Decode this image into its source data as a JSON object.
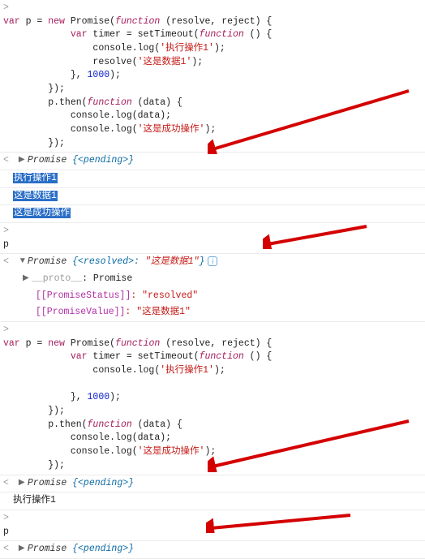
{
  "block1": {
    "l1a": "var",
    "l1b": " p = ",
    "l1c": "new",
    "l1d": " Promise(",
    "l1e": "function",
    "l1f": " (resolve, reject) {",
    "l2a": "            var",
    "l2b": " timer = setTimeout(",
    "l2c": "function",
    "l2d": " () {",
    "l3a": "                console.log(",
    "l3b": "'执行操作1'",
    "l3c": ");",
    "l4a": "                resolve(",
    "l4b": "'这是数据1'",
    "l4c": ");",
    "l5a": "            }, ",
    "l5b": "1000",
    "l5c": ");",
    "l6": "        });",
    "l7a": "        p.then(",
    "l7b": "function",
    "l7c": " (data) {",
    "l8": "            console.log(data);",
    "l9a": "            console.log(",
    "l9b": "'这是成功操作'",
    "l9c": ");",
    "l10": "        });"
  },
  "pendingA": {
    "a": "Promise ",
    "b": "{<pending>}"
  },
  "logs": {
    "a": "执行操作1",
    "b": "这是数据1",
    "c": "这是成功操作"
  },
  "p_line": "p",
  "resolved": {
    "a": "Promise ",
    "b": "{<resolved>: ",
    "c": "\"这是数据1\"",
    "d": "}",
    "proto_k": "__proto__",
    "proto_v": ": Promise",
    "ps_k": "[[PromiseStatus]]",
    "ps_v": ": \"resolved\"",
    "pv_k": "[[PromiseValue]]",
    "pv_v": ": \"这是数据1\""
  },
  "block2": {
    "l1a": "var",
    "l1b": " p = ",
    "l1c": "new",
    "l1d": " Promise(",
    "l1e": "function",
    "l1f": " (resolve, reject) {",
    "l2a": "            var",
    "l2b": " timer = setTimeout(",
    "l2c": "function",
    "l2d": " () {",
    "l3a": "                console.log(",
    "l3b": "'执行操作1'",
    "l3c": ");",
    "l5a": "            }, ",
    "l5b": "1000",
    "l5c": ");",
    "l6": "        });",
    "l7a": "        p.then(",
    "l7b": "function",
    "l7c": " (data) {",
    "l8": "            console.log(data);",
    "l9a": "            console.log(",
    "l9b": "'这是成功操作'",
    "l9c": ");",
    "l10": "        });"
  },
  "pendingB": {
    "a": "Promise ",
    "b": "{<pending>}"
  },
  "log2": "执行操作1",
  "p_line2": "p",
  "pendingC": {
    "a": "Promise ",
    "b": "{<pending>}"
  }
}
